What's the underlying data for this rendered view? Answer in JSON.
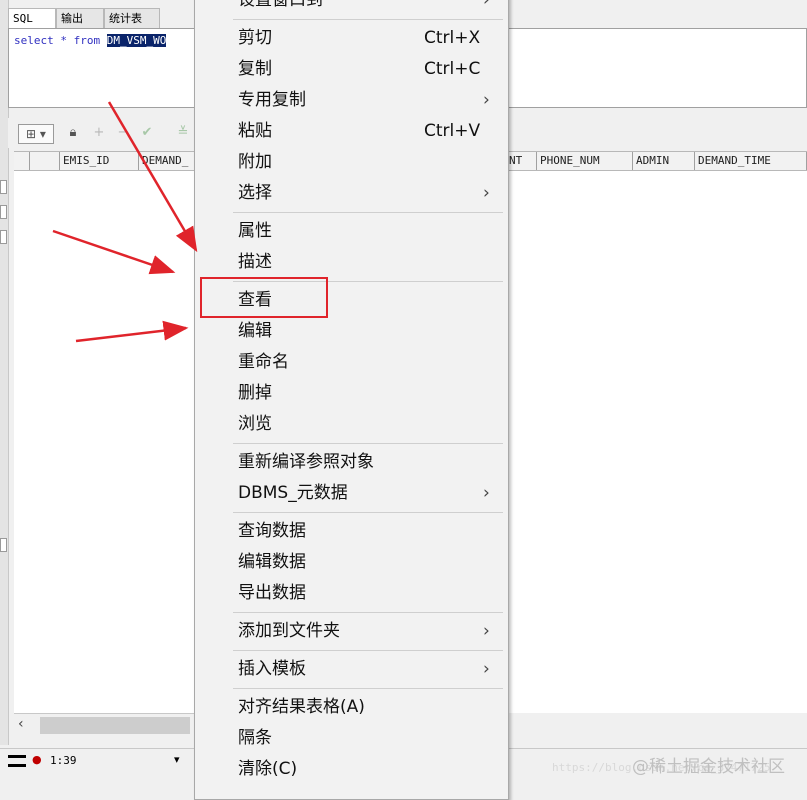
{
  "editor": {
    "tabs": [
      "SQL",
      "输出",
      "统计表"
    ],
    "sql_keyword_select": "select",
    "sql_star": "*",
    "sql_keyword_from": "from",
    "sql_table": "DM_VSM_WO"
  },
  "grid": {
    "columns": [
      "EMIS_ID",
      "DEMAND_",
      "NT",
      "PHONE_NUM",
      "ADMIN",
      "DEMAND_TIME"
    ]
  },
  "status": {
    "time": "1:39",
    "watermark": "@稀土掘金技术社区",
    "url_watermark": "https://blog.csdn.net/qq_37471725"
  },
  "context_menu": {
    "items": [
      {
        "label": "设置窗口到",
        "shortcut": "",
        "submenu": true
      },
      {
        "label": "剪切",
        "shortcut": "Ctrl+X",
        "submenu": false
      },
      {
        "label": "复制",
        "shortcut": "Ctrl+C",
        "submenu": false
      },
      {
        "label": "专用复制",
        "shortcut": "",
        "submenu": true
      },
      {
        "label": "粘贴",
        "shortcut": "Ctrl+V",
        "submenu": false
      },
      {
        "label": "附加",
        "shortcut": "",
        "submenu": false
      },
      {
        "label": "选择",
        "shortcut": "",
        "submenu": true
      },
      {
        "label": "属性",
        "shortcut": "",
        "submenu": false
      },
      {
        "label": "描述",
        "shortcut": "",
        "submenu": false
      },
      {
        "label": "查看",
        "shortcut": "",
        "submenu": false
      },
      {
        "label": "编辑",
        "shortcut": "",
        "submenu": false
      },
      {
        "label": "重命名",
        "shortcut": "",
        "submenu": false
      },
      {
        "label": "删掉",
        "shortcut": "",
        "submenu": false
      },
      {
        "label": "浏览",
        "shortcut": "",
        "submenu": false
      },
      {
        "label": "重新编译参照对象",
        "shortcut": "",
        "submenu": false
      },
      {
        "label": "DBMS_元数据",
        "shortcut": "",
        "submenu": true
      },
      {
        "label": "查询数据",
        "shortcut": "",
        "submenu": false
      },
      {
        "label": "编辑数据",
        "shortcut": "",
        "submenu": false
      },
      {
        "label": "导出数据",
        "shortcut": "",
        "submenu": false
      },
      {
        "label": "添加到文件夹",
        "shortcut": "",
        "submenu": true
      },
      {
        "label": "插入模板",
        "shortcut": "",
        "submenu": true
      },
      {
        "label": "对齐结果表格(A)",
        "shortcut": "",
        "submenu": false
      },
      {
        "label": "隔条",
        "shortcut": "",
        "submenu": false
      },
      {
        "label": "清除(C)",
        "shortcut": "",
        "submenu": false
      }
    ],
    "highlighted_item": "查看",
    "highlight_color": "#e0242b",
    "arrow_color": "#e0242b"
  }
}
